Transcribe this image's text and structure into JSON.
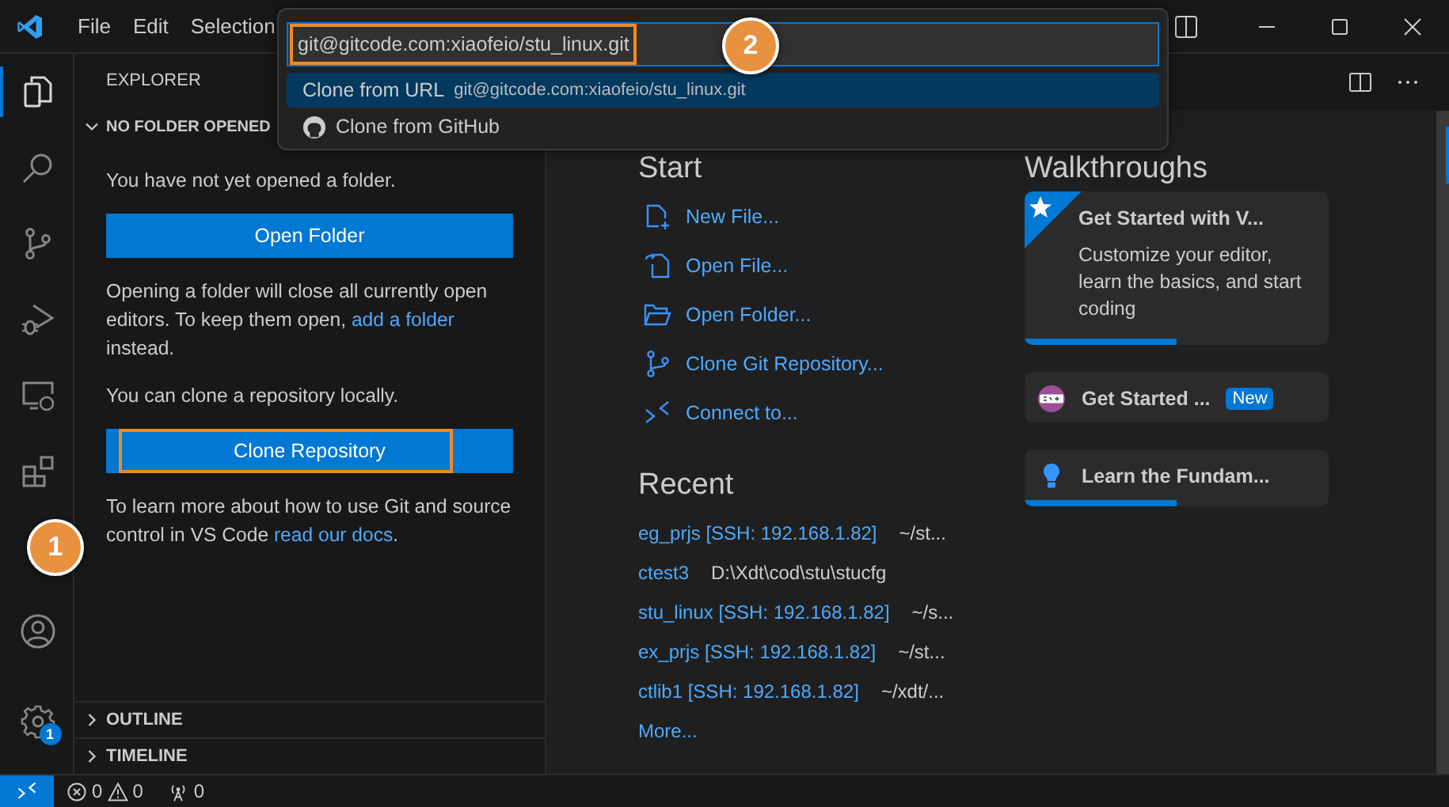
{
  "title_bar": {
    "menu": [
      "File",
      "Edit",
      "Selection"
    ]
  },
  "activity_bar": {
    "items": [
      {
        "kind": "files",
        "selected": true
      },
      {
        "kind": "search",
        "selected": false
      },
      {
        "kind": "git",
        "selected": false
      },
      {
        "kind": "debug",
        "selected": false
      },
      {
        "kind": "remote",
        "selected": false
      },
      {
        "kind": "extensions",
        "selected": false
      }
    ],
    "settings_badge": "1"
  },
  "sidebar": {
    "title": "EXPLORER",
    "section": "NO FOLDER OPENED",
    "message": "You have not yet opened a folder.",
    "open_button": "Open Folder",
    "info_before_link": "Opening a folder will close all currently open editors. To keep them open, ",
    "info_link": "add a folder",
    "info_after_link": " instead.",
    "clone_message": "You can clone a repository locally.",
    "clone_button": {
      "label": "Clone Repository",
      "highlighted": true
    },
    "learn_text": "To learn more about how to use Git and source control in VS Code ",
    "learn_link": "read our docs",
    "learn_end": ".",
    "callout": "1",
    "sections": [
      {
        "label": "OUTLINE",
        "expanded": false
      },
      {
        "label": "TIMELINE",
        "expanded": false
      }
    ]
  },
  "quick_pick": {
    "value": "git@gitcode.com:xiaofeio/stu_linux.git",
    "highlighted": true,
    "callout": "2",
    "items": [
      {
        "label": "Clone from URL",
        "detail": "git@gitcode.com:xiaofeio/stu_linux.git",
        "kind": "url",
        "selected": true
      },
      {
        "label": "Clone from GitHub",
        "kind": "github",
        "selected": false
      }
    ]
  },
  "start": {
    "title": "Start",
    "items": [
      {
        "label": "New File...",
        "kind": "new-file"
      },
      {
        "label": "Open File...",
        "kind": "open-file"
      },
      {
        "label": "Open Folder...",
        "kind": "open-folder"
      },
      {
        "label": "Clone Git Repository...",
        "kind": "git"
      },
      {
        "label": "Connect to...",
        "kind": "remote"
      }
    ]
  },
  "recent": {
    "title": "Recent",
    "items": [
      {
        "name": "eg_prjs [SSH: 192.168.1.82]",
        "path": "~/st..."
      },
      {
        "name": "ctest3",
        "path": "D:\\Xdt\\cod\\stu\\stucfg"
      },
      {
        "name": "stu_linux [SSH: 192.168.1.82]",
        "path": "~/s..."
      },
      {
        "name": "ex_prjs [SSH: 192.168.1.82]",
        "path": "~/st..."
      },
      {
        "name": "ctlib1 [SSH: 192.168.1.82]",
        "path": "~/xdt/..."
      }
    ],
    "more": "More..."
  },
  "walkthroughs": {
    "title": "Walkthroughs",
    "items": [
      {
        "kind": "star",
        "title": "Get Started with V...",
        "description": "Customize your editor, learn the basics, and start coding",
        "level": 0.5
      },
      {
        "kind": "cpp",
        "title": "Get Started ...",
        "badge": "New"
      },
      {
        "kind": "bulb",
        "title": "Learn the Fundam...",
        "level": 0.5
      }
    ]
  },
  "status_bar": {
    "errors": "0",
    "warnings": "0",
    "ports": "0"
  }
}
